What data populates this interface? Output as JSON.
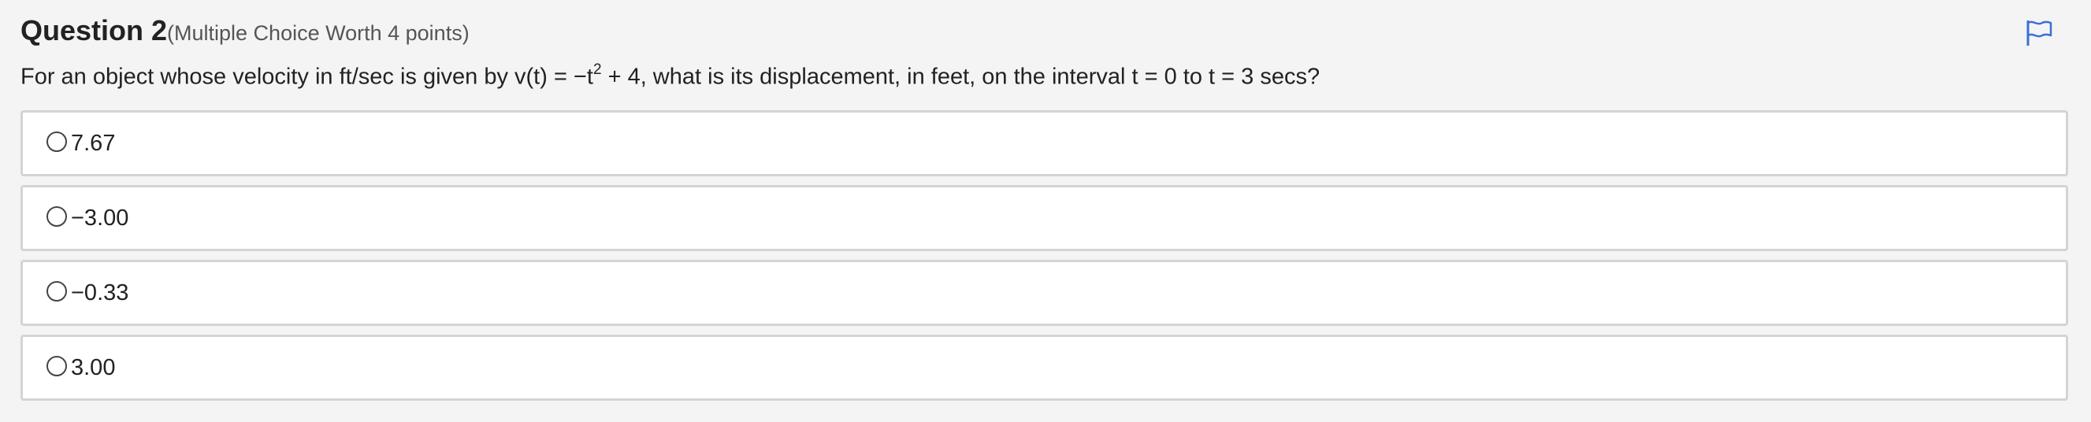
{
  "question": {
    "number_label": "Question 2",
    "points_label": "(Multiple Choice Worth 4 points)",
    "text_before": "For an object whose velocity in ft/sec is given by v(t) = −t",
    "text_superscript": "2",
    "text_after": " + 4, what is its displacement, in feet, on the interval t = 0 to t = 3 secs?",
    "flag_icon": "flag-icon"
  },
  "options": [
    {
      "label": "7.67",
      "selected": false
    },
    {
      "label": "−3.00",
      "selected": false
    },
    {
      "label": "−0.33",
      "selected": false
    },
    {
      "label": "3.00",
      "selected": false
    }
  ],
  "colors": {
    "background": "#f4f4f4",
    "option_border": "#d4d4d4",
    "flag_accent": "#3a6fd8"
  }
}
